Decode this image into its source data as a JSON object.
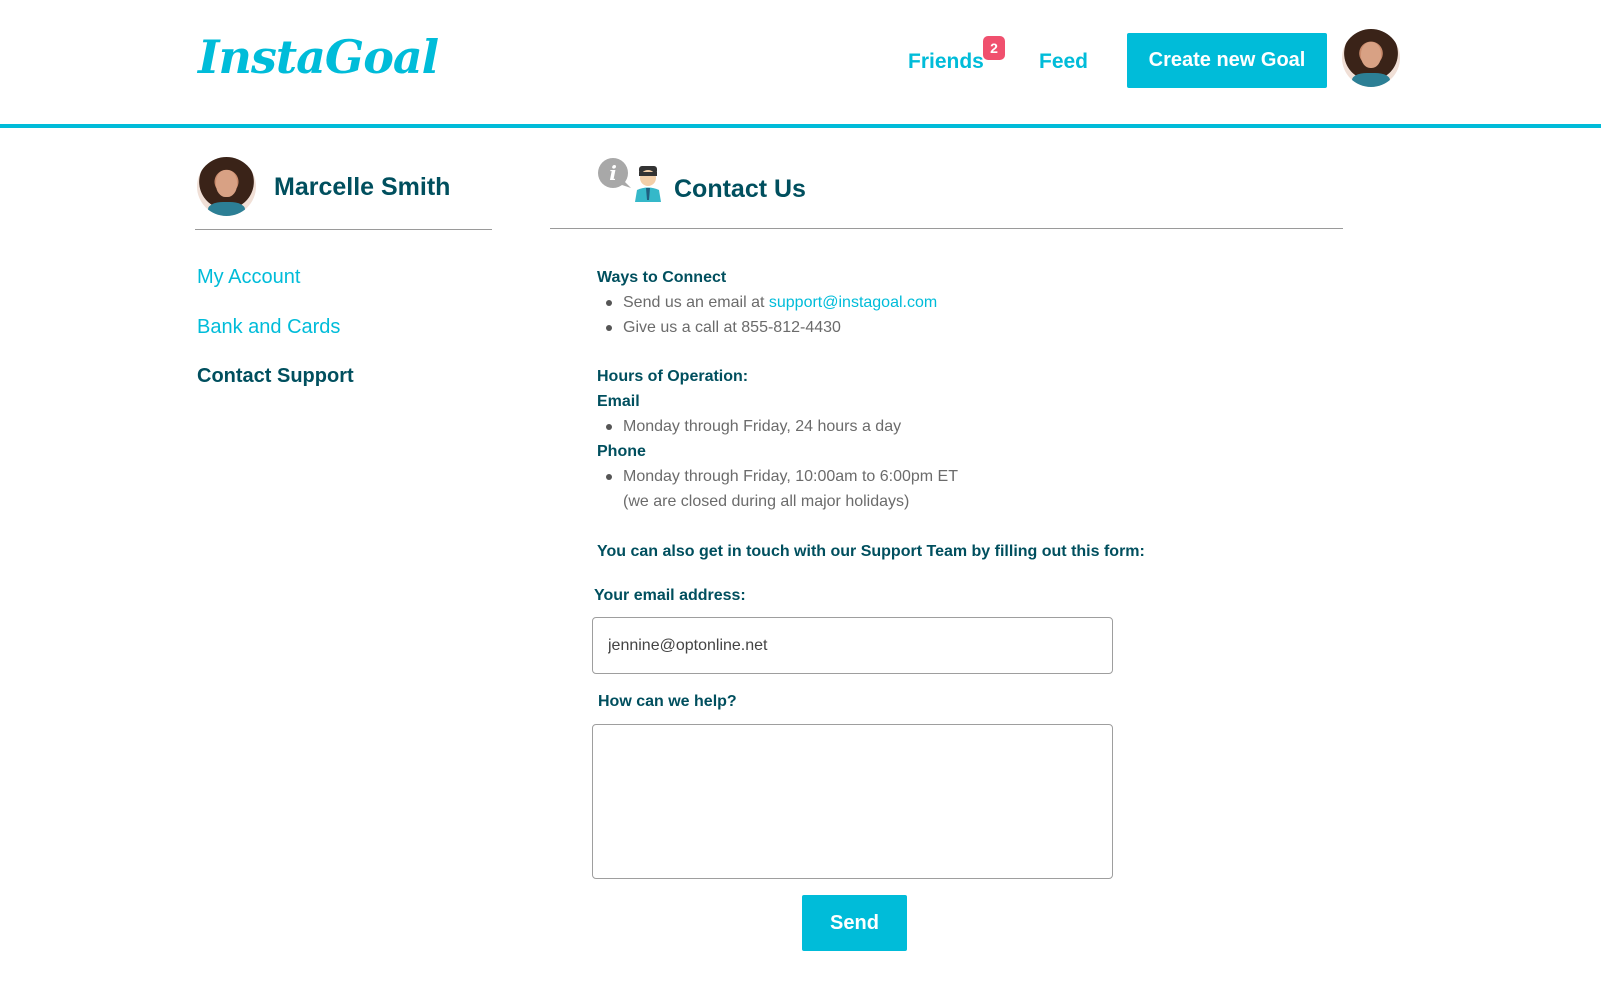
{
  "header": {
    "logo": "InstaGoal",
    "nav": {
      "friends_label": "Friends",
      "friends_badge": "2",
      "feed_label": "Feed"
    },
    "create_button": "Create new Goal",
    "avatar_icon": "user-avatar"
  },
  "sidebar": {
    "user_name": "Marcelle Smith",
    "items": [
      {
        "label": "My Account",
        "active": false
      },
      {
        "label": "Bank and Cards",
        "active": false
      },
      {
        "label": "Contact Support",
        "active": true
      }
    ]
  },
  "main": {
    "icon": "info-support-icon",
    "title": "Contact Us",
    "ways_heading": "Ways to Connect",
    "email_prefix": "Send us an email at",
    "email_address": "support@instagoal.com",
    "phone_line": "Give us a call at 855-812-4430",
    "hours_heading": "Hours of Operation:",
    "email_heading": "Email",
    "email_hours": "Monday through Friday, 24 hours a day",
    "phone_heading": "Phone",
    "phone_hours": "Monday through Friday, 10:00am to 6:00pm ET",
    "phone_note": "(we are closed during all major holidays)",
    "form_intro": "You can also get in touch with our Support Team by filling out this form:",
    "form": {
      "email_label": "Your email address:",
      "email_value": "jennine@optonline.net",
      "help_label": "How can we help?",
      "help_value": "",
      "send_label": "Send"
    }
  },
  "colors": {
    "accent": "#00bcd9",
    "dark_teal": "#004f5e",
    "badge": "#f0506e",
    "text_gray": "#6b6b6b"
  }
}
